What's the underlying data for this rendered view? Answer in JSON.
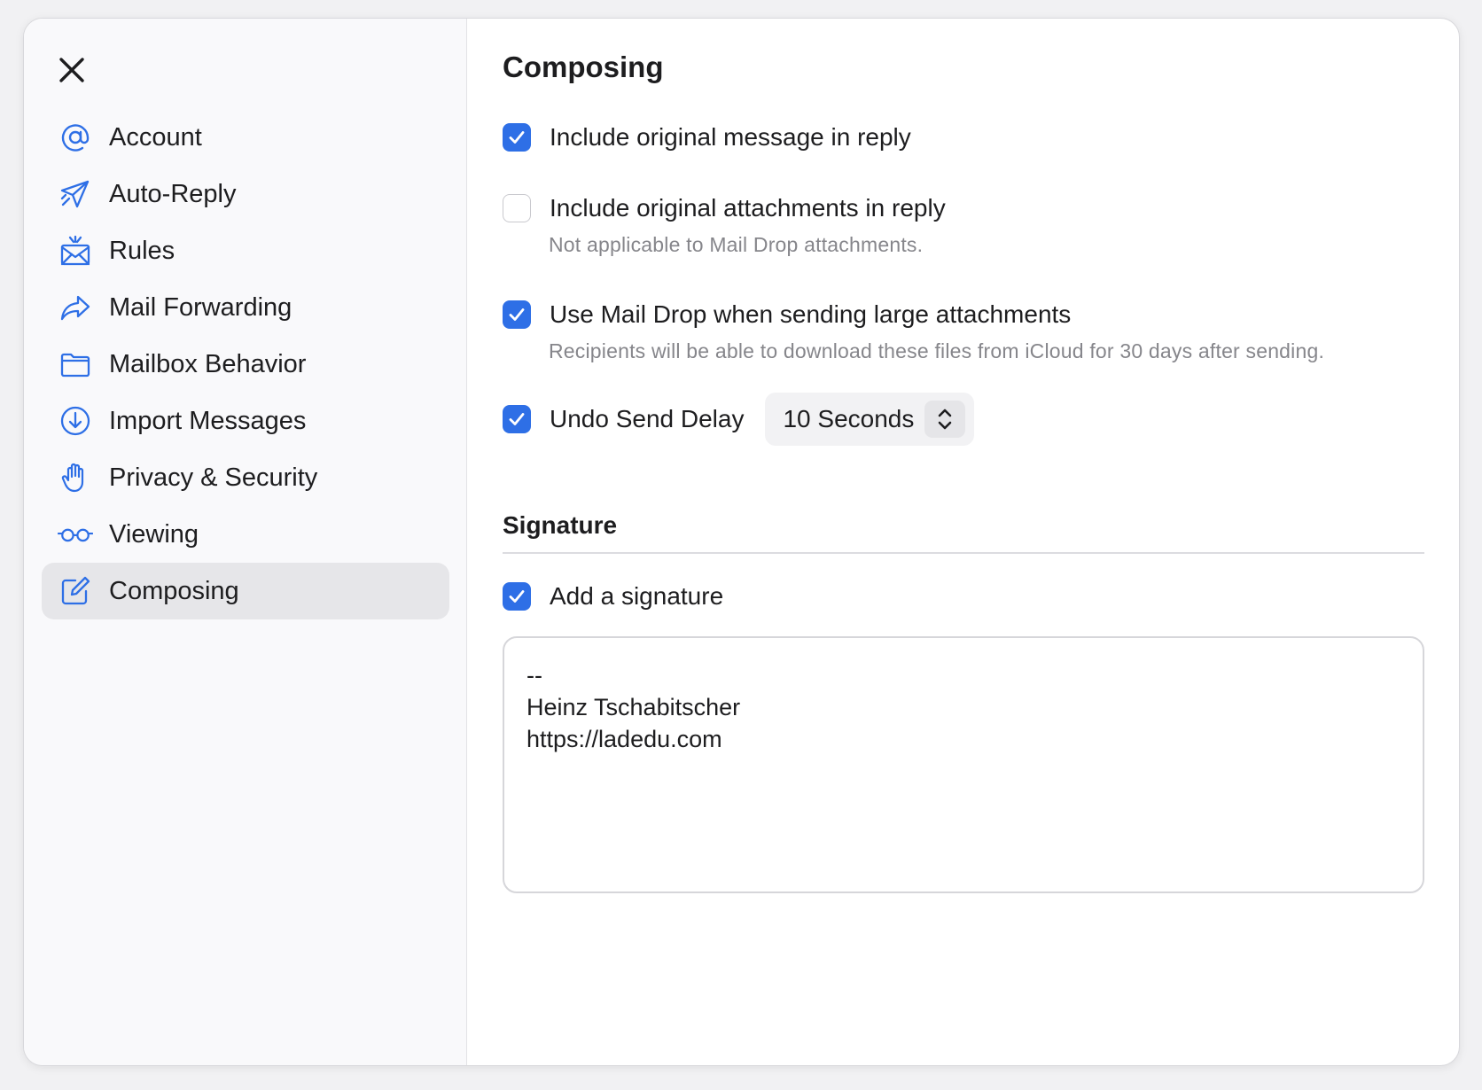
{
  "sidebar": {
    "items": [
      {
        "label": "Account",
        "icon": "at-icon"
      },
      {
        "label": "Auto-Reply",
        "icon": "paper-plane-icon"
      },
      {
        "label": "Rules",
        "icon": "envelope-rules-icon"
      },
      {
        "label": "Mail Forwarding",
        "icon": "forward-arrow-icon"
      },
      {
        "label": "Mailbox Behavior",
        "icon": "folder-icon"
      },
      {
        "label": "Import Messages",
        "icon": "download-circle-icon"
      },
      {
        "label": "Privacy & Security",
        "icon": "hand-icon"
      },
      {
        "label": "Viewing",
        "icon": "glasses-icon"
      },
      {
        "label": "Composing",
        "icon": "compose-icon",
        "active": true
      }
    ]
  },
  "main": {
    "title": "Composing",
    "options": {
      "include_message": {
        "label": "Include original message in reply",
        "checked": true
      },
      "include_attachments": {
        "label": "Include original attachments in reply",
        "checked": false,
        "hint": "Not applicable to Mail Drop attachments."
      },
      "mail_drop": {
        "label": "Use Mail Drop when sending large attachments",
        "checked": true,
        "hint": "Recipients will be able to download these files from iCloud for 30 days after sending."
      },
      "undo_send": {
        "label": "Undo Send Delay",
        "checked": true,
        "selected": "10 Seconds"
      }
    },
    "signature": {
      "title": "Signature",
      "add_label": "Add a signature",
      "add_checked": true,
      "lines": [
        "--",
        "Heinz Tschabitscher",
        "https://ladedu.com"
      ]
    }
  },
  "colors": {
    "accent": "#2e6fe6",
    "active_bg": "#e6e6e9",
    "hint_text": "#86868b"
  }
}
